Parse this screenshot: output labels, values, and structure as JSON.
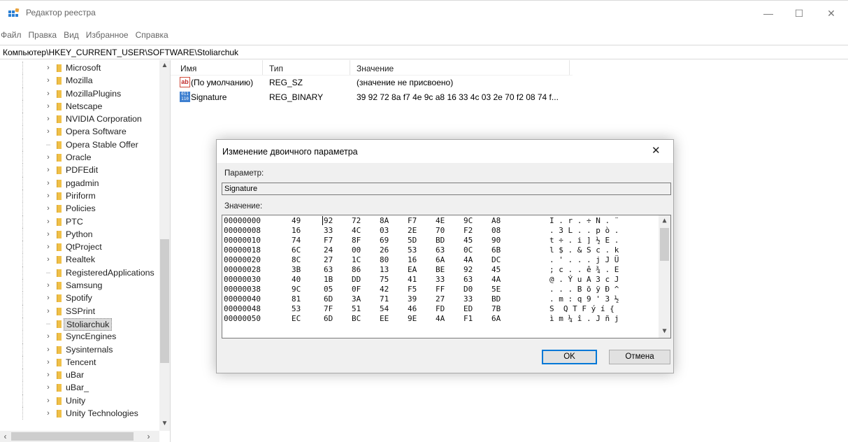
{
  "window": {
    "title": "Редактор реестра",
    "minimize": "—",
    "maximize": "☐",
    "close": "✕",
    "icon": "regedit-icon"
  },
  "menu": [
    "Файл",
    "Правка",
    "Вид",
    "Избранное",
    "Справка"
  ],
  "address": "Компьютер\\HKEY_CURRENT_USER\\SOFTWARE\\Stoliarchuk",
  "tree": {
    "items": [
      {
        "label": "Microsoft",
        "expandable": true
      },
      {
        "label": "Mozilla",
        "expandable": true
      },
      {
        "label": "MozillaPlugins",
        "expandable": true
      },
      {
        "label": "Netscape",
        "expandable": true
      },
      {
        "label": "NVIDIA Corporation",
        "expandable": true
      },
      {
        "label": "Opera Software",
        "expandable": true
      },
      {
        "label": "Opera Stable Offer",
        "expandable": false
      },
      {
        "label": "Oracle",
        "expandable": true
      },
      {
        "label": "PDFEdit",
        "expandable": true
      },
      {
        "label": "pgadmin",
        "expandable": true
      },
      {
        "label": "Piriform",
        "expandable": true
      },
      {
        "label": "Policies",
        "expandable": true
      },
      {
        "label": "PTC",
        "expandable": true
      },
      {
        "label": "Python",
        "expandable": true
      },
      {
        "label": "QtProject",
        "expandable": true
      },
      {
        "label": "Realtek",
        "expandable": true
      },
      {
        "label": "RegisteredApplications",
        "expandable": false
      },
      {
        "label": "Samsung",
        "expandable": true
      },
      {
        "label": "Spotify",
        "expandable": true
      },
      {
        "label": "SSPrint",
        "expandable": true
      },
      {
        "label": "Stoliarchuk",
        "expandable": false,
        "selected": true
      },
      {
        "label": "SyncEngines",
        "expandable": true
      },
      {
        "label": "Sysinternals",
        "expandable": true
      },
      {
        "label": "Tencent",
        "expandable": true
      },
      {
        "label": "uBar",
        "expandable": true
      },
      {
        "label": "uBar_",
        "expandable": true
      },
      {
        "label": "Unity",
        "expandable": true
      },
      {
        "label": "Unity Technologies",
        "expandable": true
      }
    ]
  },
  "list": {
    "headers": {
      "name": "Имя",
      "type": "Тип",
      "value": "Значение"
    },
    "rows": [
      {
        "icon": "string-value-icon",
        "icon_text": "ab",
        "name": "(По умолчанию)",
        "type": "REG_SZ",
        "value": "(значение не присвоено)"
      },
      {
        "icon": "binary-value-icon",
        "icon_text": "011 110",
        "name": "Signature",
        "type": "REG_BINARY",
        "value": "39 92 72 8a f7 4e 9c a8 16 33 4c 03 2e 70 f2 08 74 f..."
      }
    ]
  },
  "dialog": {
    "title": "Изменение двоичного параметра",
    "close": "✕",
    "param_label": "Параметр:",
    "param_value": "Signature",
    "value_label": "Значение:",
    "ok": "OK",
    "cancel": "Отмена",
    "hex": [
      {
        "addr": "00000000",
        "bytes": [
          "49",
          "92",
          "72",
          "8A",
          "F7",
          "4E",
          "9C",
          "A8"
        ],
        "ascii": "I . r . ÷ N . ¨"
      },
      {
        "addr": "00000008",
        "bytes": [
          "16",
          "33",
          "4C",
          "03",
          "2E",
          "70",
          "F2",
          "08"
        ],
        "ascii": ". 3 L . . p ò ."
      },
      {
        "addr": "00000010",
        "bytes": [
          "74",
          "F7",
          "8F",
          "69",
          "5D",
          "BD",
          "45",
          "90"
        ],
        "ascii": "t ÷ . i ] ½ E ."
      },
      {
        "addr": "00000018",
        "bytes": [
          "6C",
          "24",
          "00",
          "26",
          "53",
          "63",
          "0C",
          "6B"
        ],
        "ascii": "l $ . & S c . k"
      },
      {
        "addr": "00000020",
        "bytes": [
          "8C",
          "27",
          "1C",
          "80",
          "16",
          "6A",
          "4A",
          "DC"
        ],
        "ascii": ". ' . . . j J Ü"
      },
      {
        "addr": "00000028",
        "bytes": [
          "3B",
          "63",
          "86",
          "13",
          "EA",
          "BE",
          "92",
          "45"
        ],
        "ascii": "; c . . ê ¾ . E"
      },
      {
        "addr": "00000030",
        "bytes": [
          "40",
          "1B",
          "DD",
          "75",
          "41",
          "33",
          "63",
          "4A"
        ],
        "ascii": "@ . Ý u A 3 c J"
      },
      {
        "addr": "00000038",
        "bytes": [
          "9C",
          "05",
          "0F",
          "42",
          "F5",
          "FF",
          "D0",
          "5E"
        ],
        "ascii": ". . . B õ ÿ Ð ^"
      },
      {
        "addr": "00000040",
        "bytes": [
          "81",
          "6D",
          "3A",
          "71",
          "39",
          "27",
          "33",
          "BD"
        ],
        "ascii": ". m : q 9 ' 3 ½"
      },
      {
        "addr": "00000048",
        "bytes": [
          "53",
          "7F",
          "51",
          "54",
          "46",
          "FD",
          "ED",
          "7B"
        ],
        "ascii": "S  Q T F ý í {"
      },
      {
        "addr": "00000050",
        "bytes": [
          "EC",
          "6D",
          "BC",
          "EE",
          "9E",
          "4A",
          "F1",
          "6A"
        ],
        "ascii": "ì m ¼ î . J ñ j"
      }
    ]
  }
}
